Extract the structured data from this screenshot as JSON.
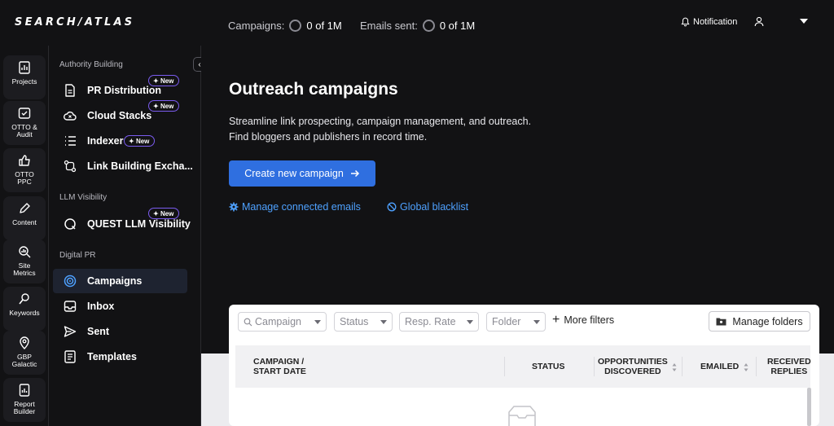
{
  "app": {
    "logo": "SEARCH/ATLAS"
  },
  "topbar": {
    "campaigns_label": "Campaigns:",
    "campaigns_value": "0 of 1M",
    "emails_label": "Emails sent:",
    "emails_value": "0 of 1M",
    "notification_label": "Notification"
  },
  "rail": {
    "items": [
      {
        "label": "Projects",
        "icon": "projects-icon"
      },
      {
        "label": "OTTO & Audit",
        "icon": "audit-icon"
      },
      {
        "label": "OTTO PPC",
        "icon": "thumbs-up-icon"
      },
      {
        "label": "Content",
        "icon": "pen-icon"
      },
      {
        "label": "Site Metrics",
        "icon": "metrics-icon"
      },
      {
        "label": "Keywords",
        "icon": "keywords-icon"
      },
      {
        "label": "GBP Galactic",
        "icon": "location-pin-icon"
      },
      {
        "label": "Report Builder",
        "icon": "report-icon"
      }
    ]
  },
  "side": {
    "section_authority": "Authority Building",
    "section_llm": "LLM Visibility",
    "section_pr": "Digital PR",
    "badge_new": "New",
    "items": {
      "pr_distribution": "PR Distribution",
      "cloud_stacks": "Cloud Stacks",
      "indexer": "Indexer",
      "link_building": "Link Building Excha...",
      "quest_llm": "QUEST LLM Visibility",
      "campaigns": "Campaigns",
      "inbox": "Inbox",
      "sent": "Sent",
      "templates": "Templates"
    },
    "active": "campaigns"
  },
  "main": {
    "title": "Outreach campaigns",
    "desc_line1": "Streamline link prospecting, campaign management, and outreach.",
    "desc_line2": "Find bloggers and publishers in record time.",
    "cta": "Create new campaign",
    "link_emails": "Manage connected emails",
    "link_blacklist": "Global blacklist"
  },
  "filters": {
    "campaign": "Campaign",
    "status": "Status",
    "resp_rate": "Resp. Rate",
    "folder": "Folder",
    "more": "More filters",
    "manage_folders": "Manage folders"
  },
  "table": {
    "col_campaign_1": "CAMPAIGN /",
    "col_campaign_2": "START DATE",
    "col_status": "STATUS",
    "col_opps_1": "OPPORTUNITIES",
    "col_opps_2": "DISCOVERED",
    "col_emailed": "EMAILED",
    "col_replies_1": "RECEIVED",
    "col_replies_2": "REPLIES"
  },
  "colors": {
    "accent": "#2f6fe0",
    "link": "#4ea1ff",
    "badge_border": "#7b5cf0",
    "bg": "#121214"
  }
}
